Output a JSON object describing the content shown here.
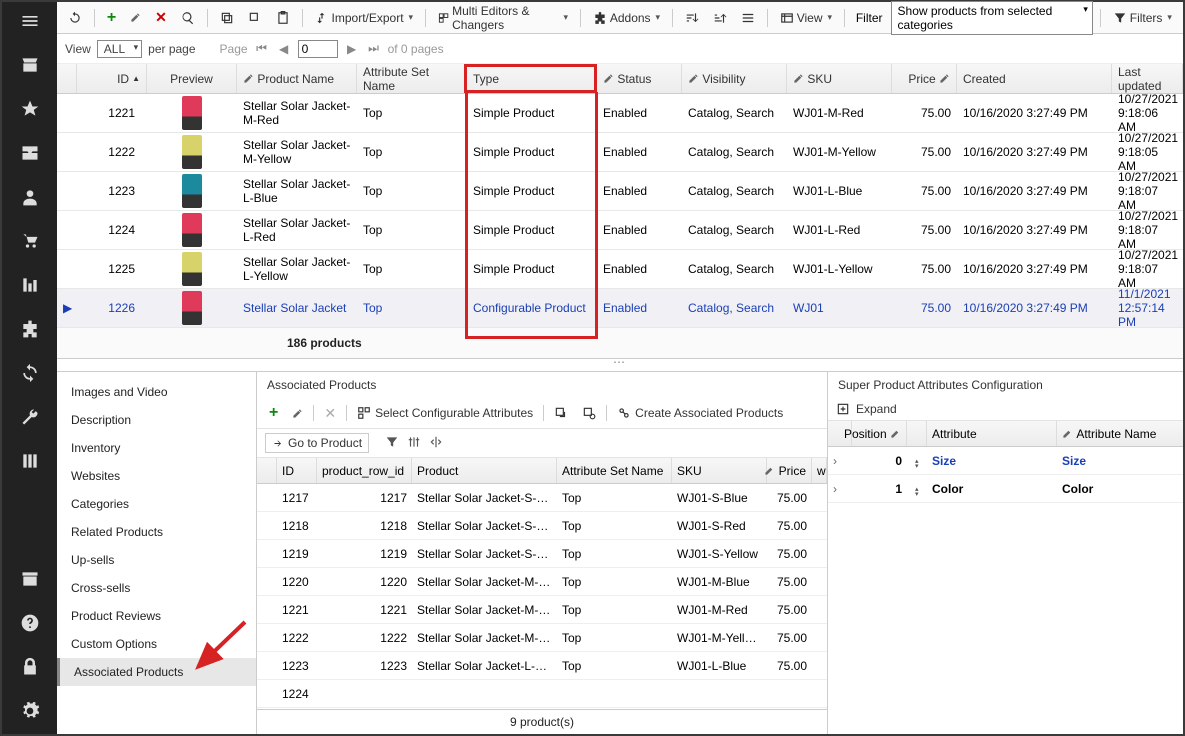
{
  "toolbar": {
    "import_export": "Import/Export",
    "multi_editors": "Multi Editors & Changers",
    "addons": "Addons",
    "view": "View",
    "filter_label": "Filter",
    "filter_value": "Show products from selected categories",
    "filters": "Filters"
  },
  "pager": {
    "view": "View",
    "all": "ALL",
    "per_page": "per page",
    "page": "Page",
    "page_num": "0",
    "of_pages": "of 0 pages"
  },
  "columns": {
    "id": "ID",
    "preview": "Preview",
    "product_name": "Product Name",
    "attr_set": "Attribute Set Name",
    "type": "Type",
    "status": "Status",
    "visibility": "Visibility",
    "sku": "SKU",
    "price": "Price",
    "created": "Created",
    "updated": "Last updated"
  },
  "rows": [
    {
      "id": "1221",
      "name": "Stellar Solar Jacket-M-Red",
      "attr": "Top",
      "type": "Simple Product",
      "status": "Enabled",
      "vis": "Catalog, Search",
      "sku": "WJ01-M-Red",
      "price": "75.00",
      "created": "10/16/2020 3:27:49 PM",
      "updated": "10/27/2021 9:18:06 AM",
      "thumb": "#e03a5a"
    },
    {
      "id": "1222",
      "name": "Stellar Solar Jacket-M-Yellow",
      "attr": "Top",
      "type": "Simple Product",
      "status": "Enabled",
      "vis": "Catalog, Search",
      "sku": "WJ01-M-Yellow",
      "price": "75.00",
      "created": "10/16/2020 3:27:49 PM",
      "updated": "10/27/2021 9:18:05 AM",
      "thumb": "#d8d26a"
    },
    {
      "id": "1223",
      "name": "Stellar Solar Jacket-L-Blue",
      "attr": "Top",
      "type": "Simple Product",
      "status": "Enabled",
      "vis": "Catalog, Search",
      "sku": "WJ01-L-Blue",
      "price": "75.00",
      "created": "10/16/2020 3:27:49 PM",
      "updated": "10/27/2021 9:18:07 AM",
      "thumb": "#1a8a9c"
    },
    {
      "id": "1224",
      "name": "Stellar Solar Jacket-L-Red",
      "attr": "Top",
      "type": "Simple Product",
      "status": "Enabled",
      "vis": "Catalog, Search",
      "sku": "WJ01-L-Red",
      "price": "75.00",
      "created": "10/16/2020 3:27:49 PM",
      "updated": "10/27/2021 9:18:07 AM",
      "thumb": "#e03a5a"
    },
    {
      "id": "1225",
      "name": "Stellar Solar Jacket-L-Yellow",
      "attr": "Top",
      "type": "Simple Product",
      "status": "Enabled",
      "vis": "Catalog, Search",
      "sku": "WJ01-L-Yellow",
      "price": "75.00",
      "created": "10/16/2020 3:27:49 PM",
      "updated": "10/27/2021 9:18:07 AM",
      "thumb": "#d8d26a"
    },
    {
      "id": "1226",
      "name": "Stellar Solar Jacket",
      "attr": "Top",
      "type": "Configurable Product",
      "status": "Enabled",
      "vis": "Catalog, Search",
      "sku": "WJ01",
      "price": "75.00",
      "created": "10/16/2020 3:27:49 PM",
      "updated": "11/1/2021 12:57:14 PM",
      "thumb": "#e03a5a",
      "sel": true
    }
  ],
  "footer_count": "186 products",
  "tabs": [
    "Images and Video",
    "Description",
    "Inventory",
    "Websites",
    "Categories",
    "Related Products",
    "Up-sells",
    "Cross-sells",
    "Product Reviews",
    "Custom Options",
    "Associated Products"
  ],
  "active_tab": "Associated Products",
  "assoc": {
    "title": "Associated Products",
    "select_attrs": "Select Configurable Attributes",
    "create_assoc": "Create Associated Products",
    "go_to_product": "Go to Product",
    "cols": {
      "id": "ID",
      "prid": "product_row_id",
      "product": "Product",
      "attr": "Attribute Set Name",
      "sku": "SKU",
      "price": "Price",
      "w": "w"
    },
    "rows": [
      {
        "id": "1217",
        "prid": "1217",
        "product": "Stellar Solar Jacket-S-Blue",
        "attr": "Top",
        "sku": "WJ01-S-Blue",
        "price": "75.00"
      },
      {
        "id": "1218",
        "prid": "1218",
        "product": "Stellar Solar Jacket-S-Red",
        "attr": "Top",
        "sku": "WJ01-S-Red",
        "price": "75.00"
      },
      {
        "id": "1219",
        "prid": "1219",
        "product": "Stellar Solar Jacket-S-Yellow",
        "attr": "Top",
        "sku": "WJ01-S-Yellow",
        "price": "75.00"
      },
      {
        "id": "1220",
        "prid": "1220",
        "product": "Stellar Solar Jacket-M-Blue",
        "attr": "Top",
        "sku": "WJ01-M-Blue",
        "price": "75.00"
      },
      {
        "id": "1221",
        "prid": "1221",
        "product": "Stellar Solar Jacket-M-Red",
        "attr": "Top",
        "sku": "WJ01-M-Red",
        "price": "75.00"
      },
      {
        "id": "1222",
        "prid": "1222",
        "product": "Stellar Solar Jacket-M-Yell…",
        "attr": "Top",
        "sku": "WJ01-M-Yell…",
        "price": "75.00"
      },
      {
        "id": "1223",
        "prid": "1223",
        "product": "Stellar Solar Jacket-L-Blue",
        "attr": "Top",
        "sku": "WJ01-L-Blue",
        "price": "75.00"
      },
      {
        "id": "1224",
        "prid": "",
        "product": "",
        "attr": "",
        "sku": "",
        "price": ""
      }
    ],
    "footer": "9 product(s)"
  },
  "attrs_panel": {
    "title": "Super Product Attributes Configuration",
    "expand": "Expand",
    "cols": {
      "position": "Position",
      "attribute": "Attribute",
      "attr_name": "Attribute Name"
    },
    "rows": [
      {
        "pos": "0",
        "attr": "Size",
        "name": "Size",
        "link": true
      },
      {
        "pos": "1",
        "attr": "Color",
        "name": "Color"
      }
    ]
  }
}
